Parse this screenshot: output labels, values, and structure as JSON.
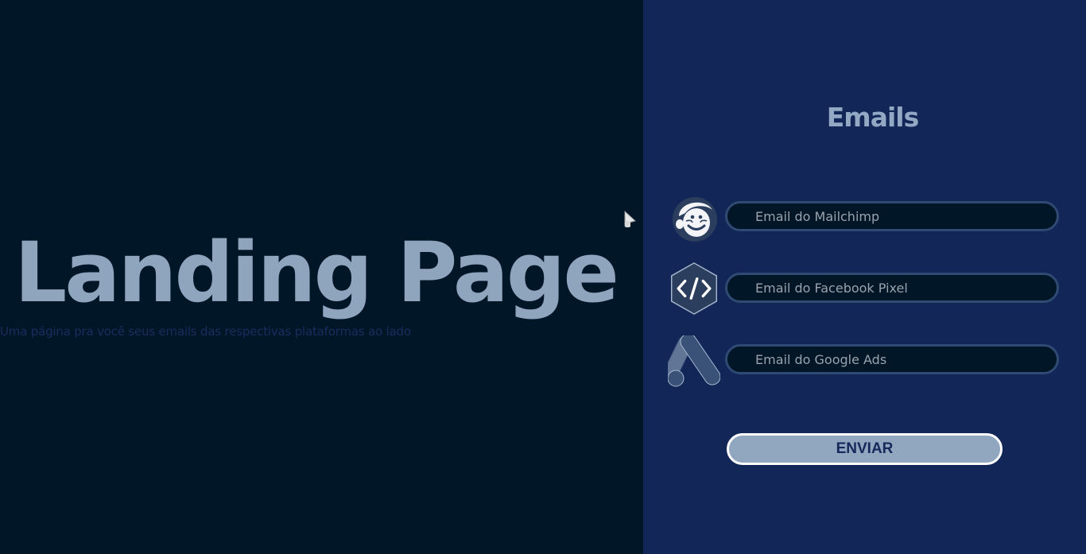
{
  "hero": {
    "title": "Landing Page",
    "subtitle": "Uma página pra você seus emails das respectivas plataformas ao lado"
  },
  "panel": {
    "title": "Emails",
    "fields": [
      {
        "icon": "mailchimp-icon",
        "placeholder": "Email do Mailchimp"
      },
      {
        "icon": "code-icon",
        "placeholder": "Email do Facebook Pixel"
      },
      {
        "icon": "google-ads-icon",
        "placeholder": "Email do Google Ads"
      }
    ],
    "submit_label": "ENVIAR"
  },
  "colors": {
    "left_background": "#011627",
    "right_background": "#122658",
    "accent": "#91a6bf"
  }
}
